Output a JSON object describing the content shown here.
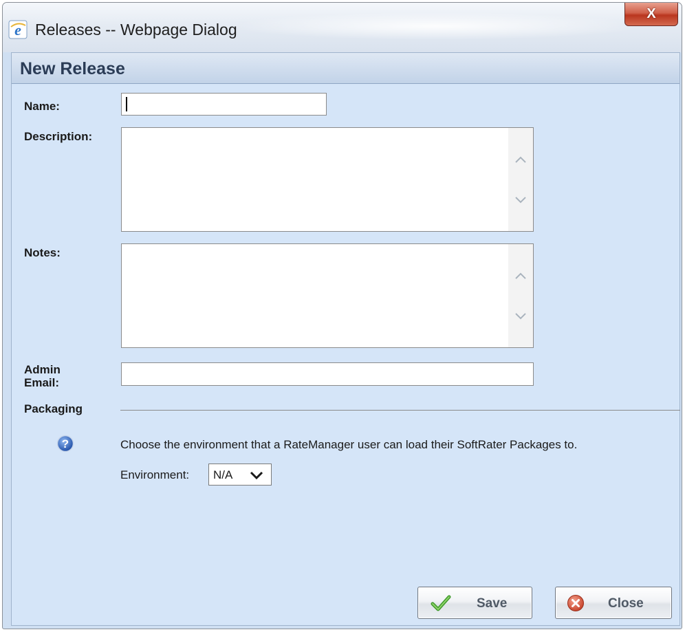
{
  "window": {
    "title": "Releases -- Webpage Dialog",
    "close_glyph": "X",
    "icon": "ie-icon"
  },
  "section": {
    "title": "New Release"
  },
  "form": {
    "name": {
      "label": "Name:",
      "value": ""
    },
    "description": {
      "label": "Description:",
      "value": ""
    },
    "notes": {
      "label": "Notes:",
      "value": ""
    },
    "admin_email": {
      "label_line1": "Admin",
      "label_line2": "Email:",
      "value": ""
    }
  },
  "packaging": {
    "heading": "Packaging",
    "help_text": "Choose the environment that a RateManager user can load their SoftRater Packages to.",
    "environment_label": "Environment:",
    "environment_value": "N/A"
  },
  "buttons": {
    "save": "Save",
    "close": "Close"
  },
  "colors": {
    "dialog_background": "#d5e5f8",
    "header_text": "#2b3c56",
    "close_button": "#c8452c"
  }
}
